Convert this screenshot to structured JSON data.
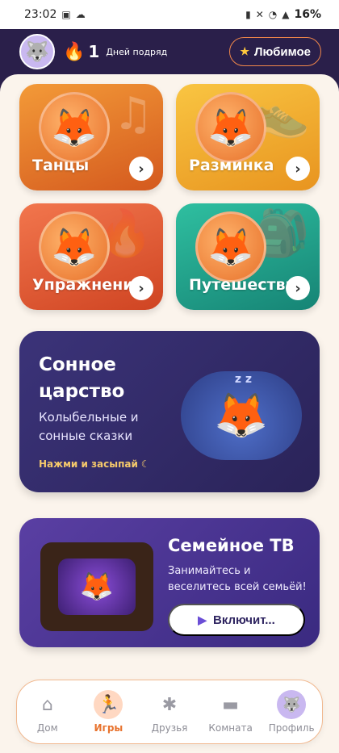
{
  "status_bar": {
    "time": "23:02",
    "battery": "16%",
    "icons": [
      "photo-icon",
      "cloud-icon",
      "battery-saver-icon",
      "mute-icon",
      "wifi-icon",
      "signal-icon"
    ]
  },
  "header": {
    "streak_count": "1",
    "streak_label": "Дней подряд",
    "favorite_label": "Любимое"
  },
  "tiles": [
    {
      "label": "Танцы",
      "icon": "music-note-icon",
      "color": "#e8792c"
    },
    {
      "label": "Разминка",
      "icon": "sneaker-icon",
      "color": "#f2b131"
    },
    {
      "label": "Упражнения",
      "icon": "flame-icon",
      "color": "#e45b37"
    },
    {
      "label": "Путешествие",
      "icon": "backpack-icon",
      "color": "#22a58c"
    }
  ],
  "sleep_card": {
    "title": "Сонное царство",
    "subtitle": "Колыбельные и сонные сказки",
    "cta": "Нажми и засыпай"
  },
  "family_card": {
    "title": "Семейное ТВ",
    "subtitle": "Занимайтесь и веселитесь всей семьёй!",
    "button_label": "Включит..."
  },
  "bottom_nav": [
    {
      "label": "Дом",
      "icon": "home-icon",
      "active": false
    },
    {
      "label": "Игры",
      "icon": "running-icon",
      "active": true
    },
    {
      "label": "Друзья",
      "icon": "friends-icon",
      "active": false
    },
    {
      "label": "Комната",
      "icon": "sofa-icon",
      "active": false
    },
    {
      "label": "Профиль",
      "icon": "profile-avatar-icon",
      "active": false
    }
  ],
  "colors": {
    "accent": "#e8732e",
    "header_bg": "#2a1f4a",
    "page_bg": "#fbf4ec"
  }
}
